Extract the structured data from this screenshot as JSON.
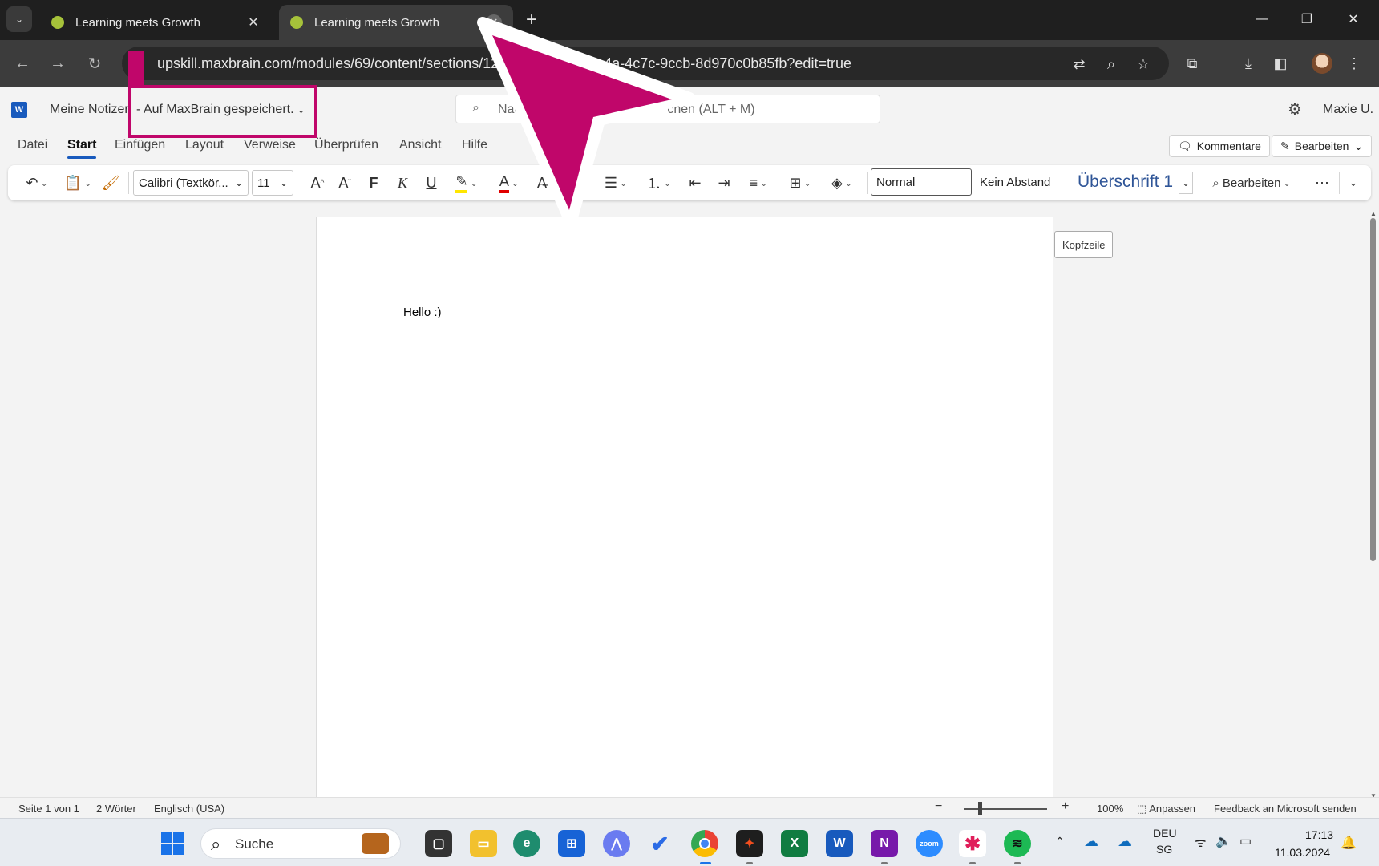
{
  "browser": {
    "tabs": [
      {
        "title": "Learning meets Growth",
        "active": false
      },
      {
        "title": "Learning meets Growth",
        "active": true
      }
    ],
    "url": "upskill.maxbrain.com/modules/69/content/sections/123/",
    "url_tail": "9e4a-4c7c-9ccb-8d970c0b85fb?edit=true"
  },
  "word": {
    "doc_name": "Meine Notizen",
    "save_status": "-  Auf MaxBrain gespeichert.",
    "search_placeholder_left": "Nach",
    "search_placeholder_right": "chen (ALT + M)",
    "user": "Maxie U.",
    "ribbon_tabs": [
      "Datei",
      "Start",
      "Einfügen",
      "Layout",
      "Verweise",
      "Überprüfen",
      "Ansicht",
      "Hilfe"
    ],
    "active_tab": "Start",
    "comments_label": "Kommentare",
    "edit_label": "Bearbeiten",
    "font_name": "Calibri (Textkör...",
    "font_size": "11",
    "styles": [
      "Normal",
      "Kein Abstand",
      "Überschrift 1"
    ],
    "ribbon_edit_label": "Bearbeiten",
    "document_text": "Hello :)",
    "header_tag": "Kopfzeile"
  },
  "statusbar": {
    "page": "Seite 1 von 1",
    "words": "2 Wörter",
    "language": "Englisch (USA)",
    "zoom": "100%",
    "fit": "Anpassen",
    "feedback": "Feedback an Microsoft senden"
  },
  "taskbar": {
    "search_label": "Suche",
    "lang_top": "DEU",
    "lang_bottom": "SG",
    "time": "17:13",
    "date": "11.03.2024"
  },
  "colors": {
    "annotation": "#c0066a",
    "word_blue": "#185abd"
  }
}
